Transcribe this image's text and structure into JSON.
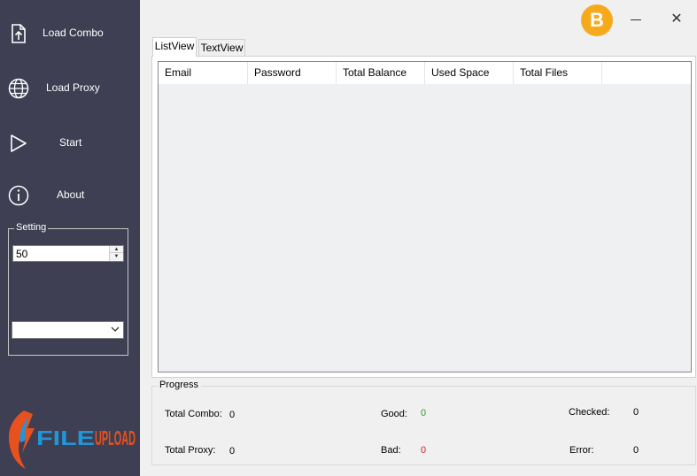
{
  "sidebar": {
    "items": [
      {
        "label": "Load Combo",
        "icon": "file-upload-icon"
      },
      {
        "label": "Load Proxy",
        "icon": "globe-icon"
      },
      {
        "label": "Start",
        "icon": "play-icon"
      },
      {
        "label": "About",
        "icon": "info-icon"
      }
    ],
    "setting": {
      "legend": "Setting",
      "threads_value": "50",
      "select_value": ""
    },
    "logo_text": "FILEUPLOAD"
  },
  "titlebar": {
    "bitcoin_symbol": "B",
    "close_symbol": "✕"
  },
  "tabs": [
    {
      "label": "ListView",
      "active": true
    },
    {
      "label": "TextView",
      "active": false
    }
  ],
  "list": {
    "columns": [
      "Email",
      "Password",
      "Total Balance",
      "Used Space",
      "Total Files"
    ],
    "rows": []
  },
  "progress": {
    "legend": "Progress",
    "total_combo_label": "Total Combo:",
    "total_combo_value": "0",
    "total_proxy_label": "Total Proxy:",
    "total_proxy_value": "0",
    "good_label": "Good:",
    "good_value": "0",
    "bad_label": "Bad:",
    "bad_value": "0",
    "checked_label": "Checked:",
    "checked_value": "0",
    "error_label": "Error:",
    "error_value": "0"
  },
  "colors": {
    "sidebar_bg": "#3e3f52",
    "bitcoin": "#f7a91c",
    "good": "#2e9e2e",
    "bad": "#d81e1e",
    "logo_orange": "#e8511e",
    "logo_blue": "#2196d9"
  }
}
